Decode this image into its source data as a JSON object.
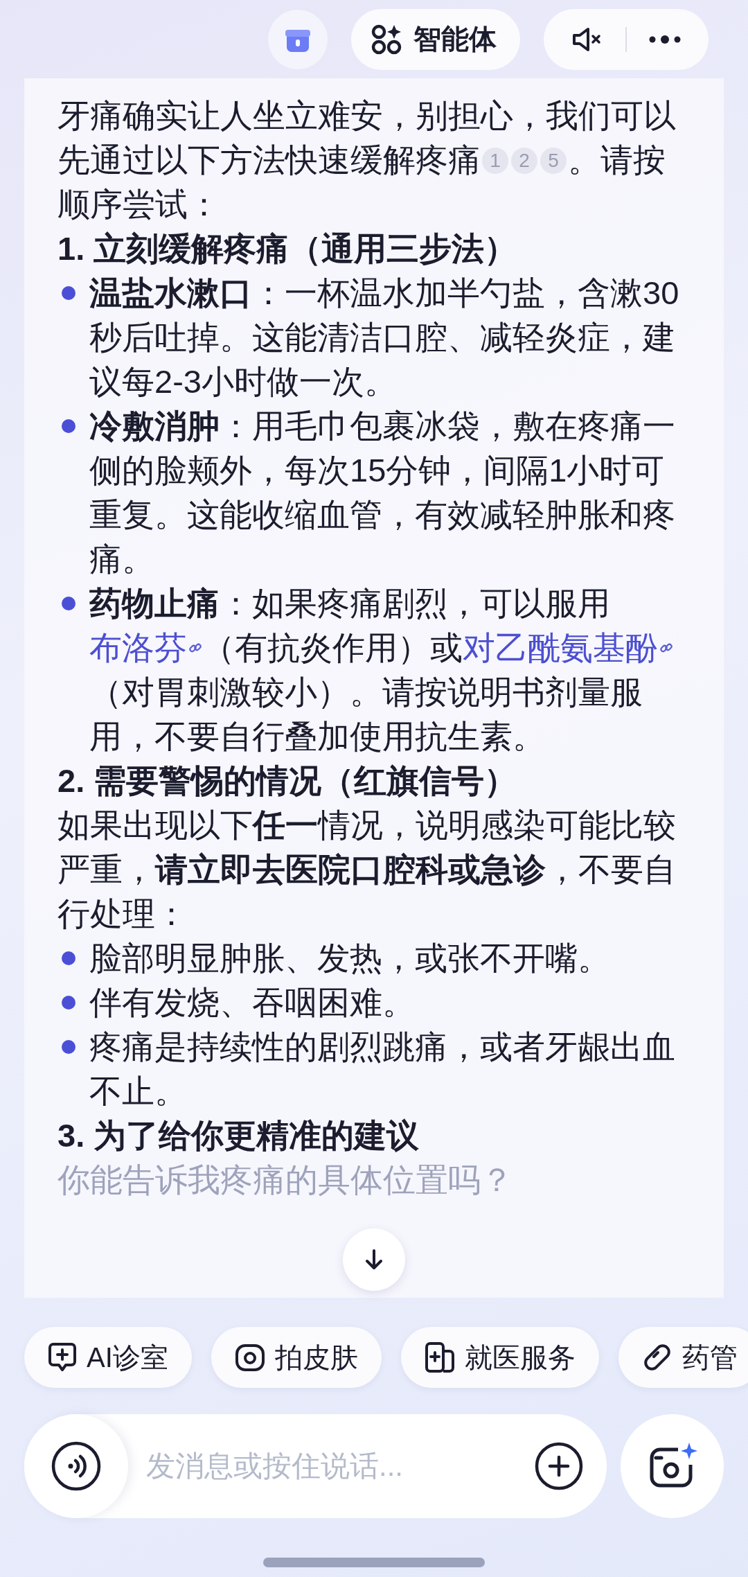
{
  "top_bar": {
    "agent_button": "智能体"
  },
  "message": {
    "intro": {
      "before": "牙痛确实让人坐立难安，别担心，我们可以先通过以下方法快速缓解疼痛",
      "citations": [
        "1",
        "2",
        "5"
      ],
      "after": "。请按顺序尝试："
    },
    "sections": [
      {
        "heading": "1. 立刻缓解疼痛（通用三步法）",
        "items": [
          {
            "segments": [
              {
                "kind": "text",
                "text": "**温盐水漱口**：一杯温水加半勺盐，含漱30秒后吐掉。这能清洁口腔、减轻炎症，建议每2-3小时做一次。"
              }
            ]
          },
          {
            "segments": [
              {
                "kind": "text",
                "text": "**冷敷消肿**：用毛巾包裹冰袋，敷在疼痛一侧的脸颊外，每次15分钟，间隔1小时可重复。这能收缩血管，有效减轻肿胀和疼痛。"
              }
            ]
          },
          {
            "segments": [
              {
                "kind": "text",
                "text": "**药物止痛**：如果疼痛剧烈，可以服用"
              },
              {
                "kind": "link",
                "text": "布洛芬"
              },
              {
                "kind": "text",
                "text": "（有抗炎作用）或"
              },
              {
                "kind": "link",
                "text": "对乙酰氨基酚"
              },
              {
                "kind": "text",
                "text": "（对胃刺激较小）。请按说明书剂量服用，不要自行叠加使用抗生素。"
              }
            ]
          }
        ]
      },
      {
        "heading": "2. 需要警惕的情况（红旗信号）",
        "paragraph": "如果出现以下**任一**情况，说明感染可能比较严重，**请立即去医院口腔科或急诊**，不要自行处理：",
        "items": [
          {
            "segments": [
              {
                "kind": "text",
                "text": "脸部明显肿胀、发热，或张不开嘴。"
              }
            ]
          },
          {
            "segments": [
              {
                "kind": "text",
                "text": "伴有发烧、吞咽困难。"
              }
            ]
          },
          {
            "segments": [
              {
                "kind": "text",
                "text": "疼痛是持续性的剧烈跳痛，或者牙龈出血不止。"
              }
            ]
          }
        ]
      },
      {
        "heading": "3. 为了给你更精准的建议",
        "faded_text": "你能告诉我疼痛的具体位置吗？"
      }
    ]
  },
  "quick_actions": [
    {
      "kind": "chat",
      "label": "AI诊室"
    },
    {
      "kind": "camera",
      "label": "拍皮肤"
    },
    {
      "kind": "clinic",
      "label": "就医服务"
    },
    {
      "kind": "pill",
      "label": "药管"
    }
  ],
  "composer": {
    "placeholder": "发消息或按住说话..."
  }
}
